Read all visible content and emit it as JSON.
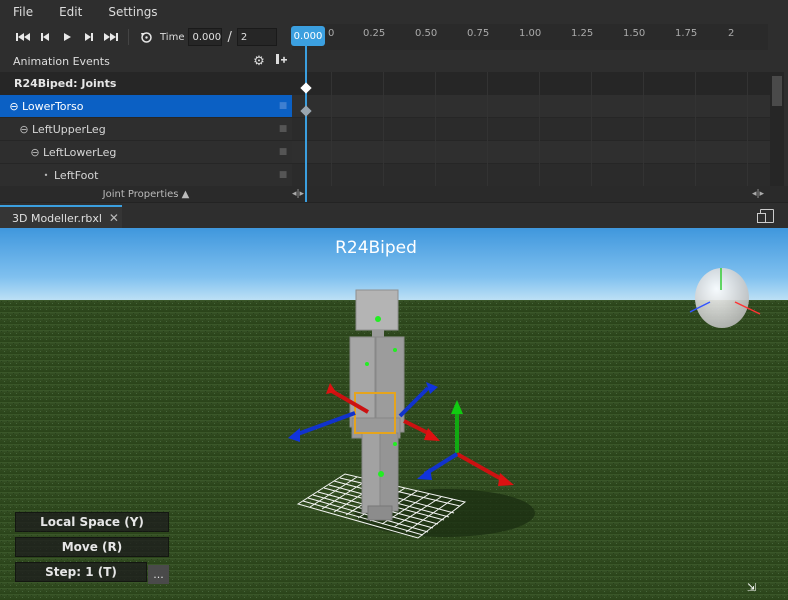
{
  "menu": [
    "File",
    "Edit",
    "Settings"
  ],
  "toolbar": {
    "time_label": "Time",
    "current_time": "0.000",
    "separator": "/",
    "end_time": "2",
    "icons": [
      "skip-to-start-icon",
      "step-back-icon",
      "play-icon",
      "step-forward-icon",
      "skip-to-end-icon",
      "loop-icon"
    ]
  },
  "timeline": {
    "playhead_value": "0.000",
    "ticks": [
      "0",
      "0.25",
      "0.50",
      "0.75",
      "1.00",
      "1.25",
      "1.50",
      "1.75",
      "2"
    ]
  },
  "animation_events": {
    "label": "Animation Events",
    "icons": [
      "gear-icon",
      "add-event-icon"
    ]
  },
  "tree": {
    "rows": [
      {
        "label": "R24Biped: Joints",
        "expander": "",
        "selected": false,
        "header": true
      },
      {
        "label": "LowerTorso",
        "expander": "⊖",
        "selected": true,
        "header": false
      },
      {
        "label": "LeftUpperLeg",
        "expander": "⊖",
        "selected": false,
        "header": false
      },
      {
        "label": "LeftLowerLeg",
        "expander": "⊖",
        "selected": false,
        "header": false
      },
      {
        "label": "LeftFoot",
        "expander": "•",
        "selected": false,
        "header": false
      }
    ]
  },
  "joint_properties": "Joint Properties ▲",
  "tab": {
    "name": "3D Modeller.rbxl",
    "close": "✕"
  },
  "viewport": {
    "model_name": "R24Biped",
    "buttons": {
      "local_space": "Local Space (Y)",
      "move": "Move (R)",
      "step": "Step: 1 (T)",
      "more": "..."
    }
  },
  "colors": {
    "accent": "#3b9fdf",
    "selected_row": "#0b60c4",
    "sky_top": "#4fa3e3",
    "grass": "#2f4a22"
  }
}
